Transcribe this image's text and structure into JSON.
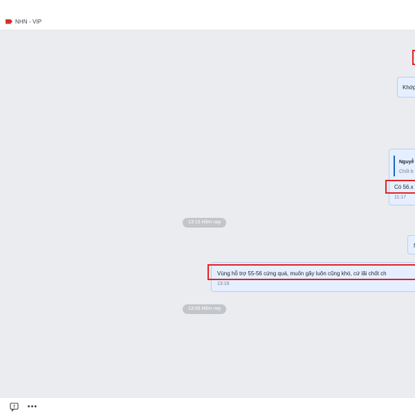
{
  "header": {
    "group_name": "NHN - VIP",
    "tag_color": "#d32f2f"
  },
  "messages": [
    {
      "text": "Khớp",
      "time": ""
    },
    {
      "quote_author": "Nguyễ",
      "quote_text": "Chốt b",
      "text": "Có 56.x",
      "time": "11:17"
    },
    {
      "text": "N",
      "time": ""
    },
    {
      "text": "Vùng hỗ trợ 55-56 cứng quá, muốn gãy luôn cũng khó, cứ lãi chốt ch",
      "time": "13:16"
    }
  ],
  "separators": [
    {
      "label": "13:15 Hôm nay"
    },
    {
      "label": "13:56 Hôm nay"
    }
  ],
  "icons": {
    "tag": "tag-icon",
    "reaction": "quick-reaction-icon",
    "more": "more-options-icon"
  },
  "toolbar": {
    "more_label": "•••"
  },
  "colors": {
    "chat_background": "#eaecef",
    "bubble_background": "#e5efff",
    "bubble_border": "#b9cdf0",
    "highlight_red": "#e02020",
    "quote_accent": "#1565c0"
  }
}
